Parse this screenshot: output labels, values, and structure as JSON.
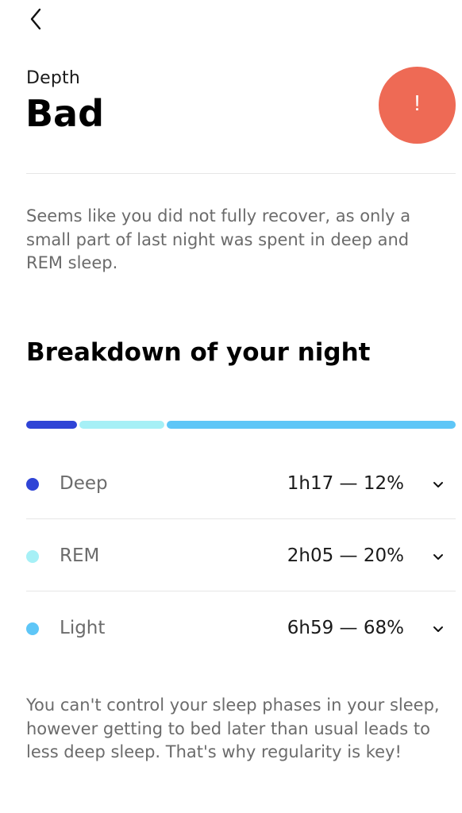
{
  "header": {
    "back_icon": "chevron-left-icon",
    "section_label": "Depth",
    "status": "Bad",
    "alert_symbol": "!",
    "alert_color": "#EE6A55"
  },
  "description": "Seems like you did not fully recover, as only a small part of last night was spent in deep and REM sleep.",
  "breakdown": {
    "title": "Breakdown of your night",
    "phases": [
      {
        "name": "Deep",
        "value": "1h17 — 12%",
        "percent": 12,
        "color": "#2F44D6",
        "icon": "chevron-down-icon"
      },
      {
        "name": "REM",
        "value": "2h05 — 20%",
        "percent": 20,
        "color": "#A6F0F6",
        "icon": "chevron-down-icon"
      },
      {
        "name": "Light",
        "value": "6h59 — 68%",
        "percent": 68,
        "color": "#5EC6F7",
        "icon": "chevron-down-icon"
      }
    ]
  },
  "footer": "You can't control your sleep phases in your sleep, however getting to bed later than usual leads to less deep sleep. That's why regularity is key!"
}
